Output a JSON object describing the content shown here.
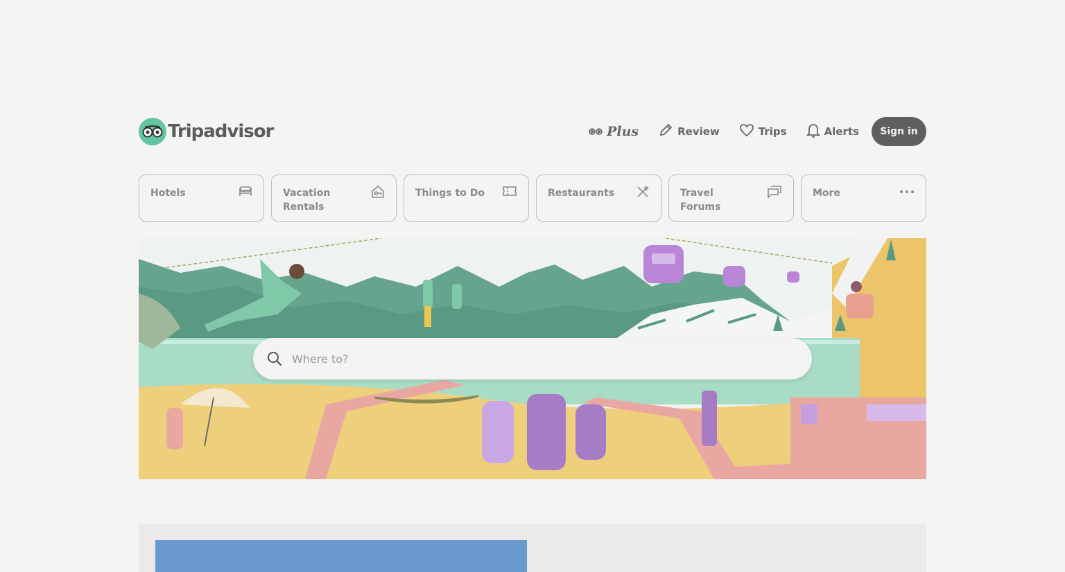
{
  "header": {
    "logo_text": "Tripadvisor",
    "nav": {
      "plus_label": "Plus",
      "review_label": "Review",
      "trips_label": "Trips",
      "alerts_label": "Alerts",
      "signin_label": "Sign in"
    }
  },
  "tabs": [
    {
      "label": "Hotels",
      "icon": "bed-icon"
    },
    {
      "label": "Vacation Rentals",
      "icon": "house-key-icon"
    },
    {
      "label": "Things to Do",
      "icon": "ticket-icon"
    },
    {
      "label": "Restaurants",
      "icon": "fork-knife-icon"
    },
    {
      "label": "Travel Forums",
      "icon": "chat-bubbles-icon"
    },
    {
      "label": "More",
      "icon": "ellipsis-icon"
    }
  ],
  "search": {
    "placeholder": "Where to?"
  },
  "colors": {
    "brand_green": "#64c6a0",
    "signin_bg": "#5f5f5f",
    "promo_blue": "#6a9acd"
  }
}
